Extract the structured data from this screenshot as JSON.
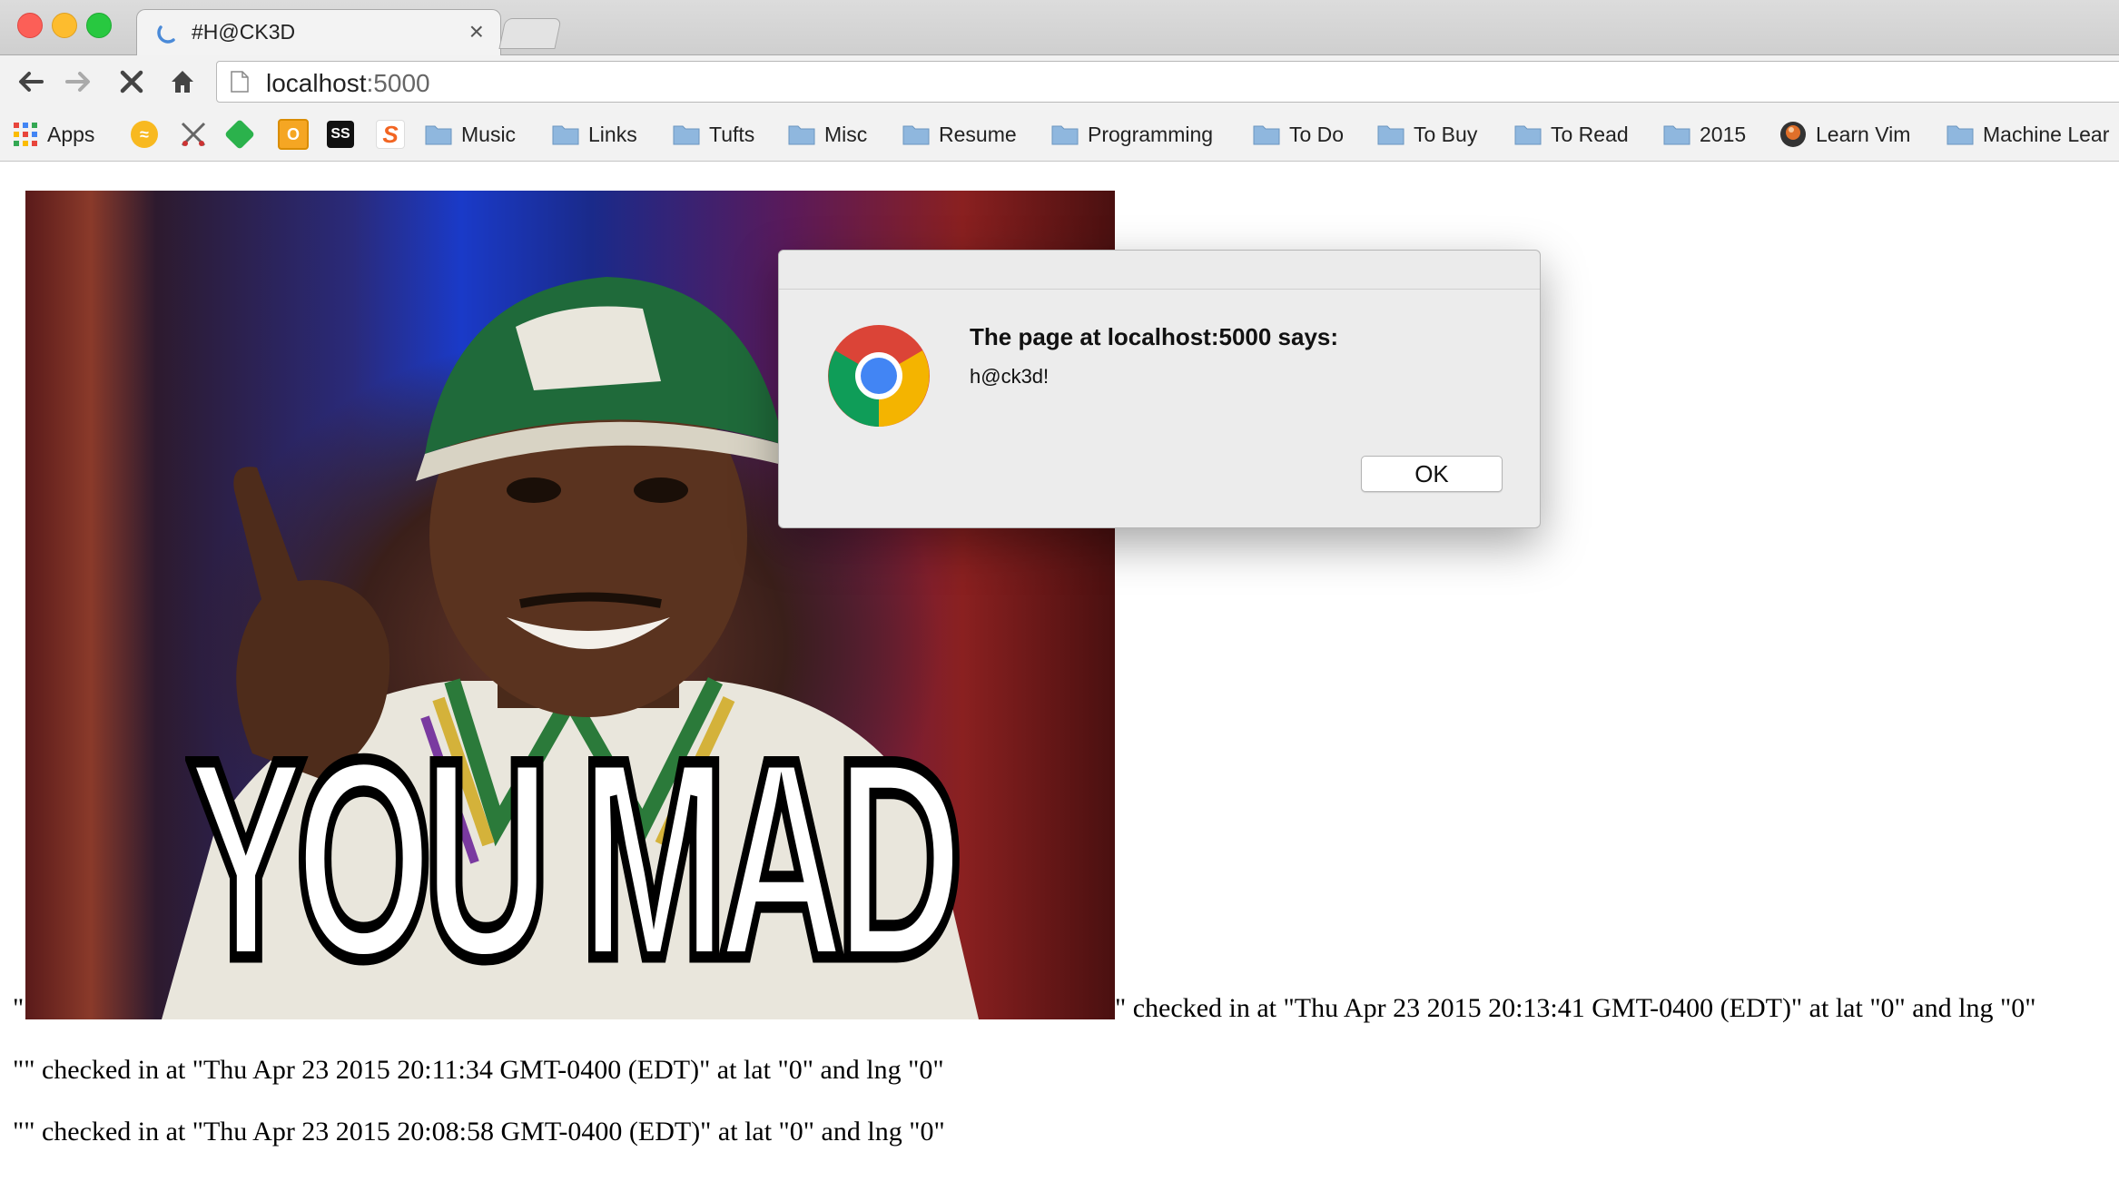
{
  "window": {
    "tab_title": "#H@CK3D"
  },
  "toolbar": {
    "url_host": "localhost",
    "url_port": ":5000"
  },
  "bookmarks": [
    {
      "label": "Apps",
      "icon": "apps-grid-icon"
    },
    {
      "label": "",
      "icon": "extension-orange-icon"
    },
    {
      "label": "",
      "icon": "scissors-icon"
    },
    {
      "label": "",
      "icon": "feedly-icon"
    },
    {
      "label": "",
      "icon": "o-extension-icon"
    },
    {
      "label": "",
      "icon": "ss-extension-icon"
    },
    {
      "label": "",
      "icon": "s-extension-icon"
    },
    {
      "label": "Music",
      "icon": "folder-icon"
    },
    {
      "label": "Links",
      "icon": "folder-icon"
    },
    {
      "label": "Tufts",
      "icon": "folder-icon"
    },
    {
      "label": "Misc",
      "icon": "folder-icon"
    },
    {
      "label": "Resume",
      "icon": "folder-icon"
    },
    {
      "label": "Programming",
      "icon": "folder-icon"
    },
    {
      "label": "To Do",
      "icon": "folder-icon"
    },
    {
      "label": "To Buy",
      "icon": "folder-icon"
    },
    {
      "label": "To Read",
      "icon": "folder-icon"
    },
    {
      "label": "2015",
      "icon": "folder-icon"
    },
    {
      "label": "Learn Vim",
      "icon": "vim-globe-icon"
    },
    {
      "label": "Machine Lear",
      "icon": "folder-icon"
    }
  ],
  "meme": {
    "caption": "YOU MAD"
  },
  "checkins": [
    {
      "lead": "\"",
      "text": "\" checked in at \"Thu Apr 23 2015 20:13:41 GMT-0400 (EDT)\" at lat \"0\" and lng \"0\""
    },
    {
      "text": "\"\" checked in at \"Thu Apr 23 2015 20:11:34 GMT-0400 (EDT)\" at lat \"0\" and lng \"0\""
    },
    {
      "text": "\"\" checked in at \"Thu Apr 23 2015 20:08:58 GMT-0400 (EDT)\" at lat \"0\" and lng \"0\""
    }
  ],
  "dialog": {
    "heading": "The page at localhost:5000 says:",
    "message": "h@ck3d!",
    "ok_label": "OK"
  },
  "colors": {
    "chrome_bg": "#f2f2f2",
    "folder": "#8fb7de",
    "dialog_bg": "#ececec"
  }
}
